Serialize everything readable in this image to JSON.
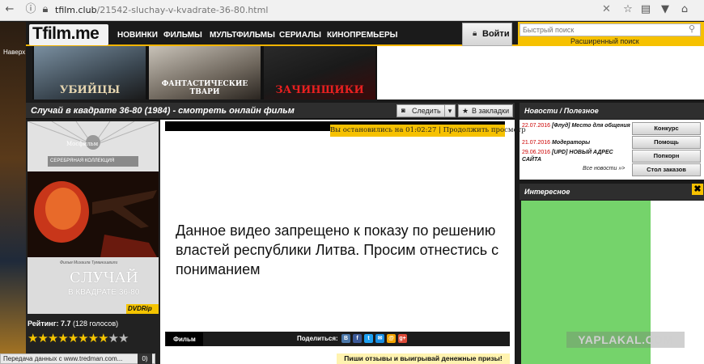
{
  "browser": {
    "url_host": "tfilm.club",
    "url_path": "/21542-sluchay-v-kvadrate-36-80.html"
  },
  "site": {
    "logo": "Tfilm.me",
    "back_to_top": "Наверх",
    "menu": [
      "НОВИНКИ",
      "ФИЛЬМЫ",
      "МУЛЬТФИЛЬМЫ",
      "СЕРИАЛЫ",
      "КИНОПРЕМЬЕРЫ"
    ],
    "login_label": "Войти",
    "search_placeholder": "Быстрый поиск",
    "advanced_search": "Расширенный поиск",
    "banners": [
      "УБИЙЦЫ",
      "ФАНТАСТИЧЕСКИЕ ТВАРИ",
      "ЗАЧИНЩИКИ"
    ]
  },
  "movie": {
    "title": "Случай в квадрате 36-80 (1984) - смотреть онлайн фильм",
    "follow_label": "Следить",
    "bookmark_label": "В закладки",
    "poster": {
      "studio": "Мосфильм",
      "collection": "СЕРЕБРЯНАЯ КОЛЛЕКЦИЯ",
      "director_line": "Фильм Михаила Туманишвили",
      "title_line1": "СЛУЧАЙ",
      "title_line2": "В КВАДРАТЕ 36-80",
      "quality": "DVDRip"
    },
    "rating_label": "Рейтинг: 7.7",
    "rating_votes": "(128 голосов)",
    "rating_value": 7.7,
    "rating_max": 10
  },
  "player": {
    "resume_text": "Вы остановились на 01:02:27 | Продолжить просмотр",
    "blocked_message": "Данное видео запрещено к показу по решению властей республики Литва. Просим отнестись с пониманием",
    "tab_film": "Фильм",
    "share_label": "Поделиться:",
    "share_icons": [
      "В",
      "f",
      "t",
      "✉",
      "@",
      "g+"
    ],
    "promo": "Пиши отзывы и выигрывай денежные призы!"
  },
  "sidebar": {
    "news_title": "Новости / Полезное",
    "news": [
      {
        "date": "22.07.2016",
        "text": "[Флуд] Место для общения"
      },
      {
        "date": "21.07.2016",
        "text": "Модераторы"
      },
      {
        "date": "29.06.2016",
        "text": "[UPD] НОВЫЙ АДРЕС САЙТА"
      }
    ],
    "all_news": "Все новости »>",
    "buttons": [
      "Конкурс",
      "Помощь",
      "Попкорн",
      "Стол заказов"
    ],
    "interest_title": "Интересное"
  },
  "status": {
    "text": "Передача данных с www.tredman.com...",
    "count": "0)"
  },
  "watermark": "YAPLAKAL.COM"
}
